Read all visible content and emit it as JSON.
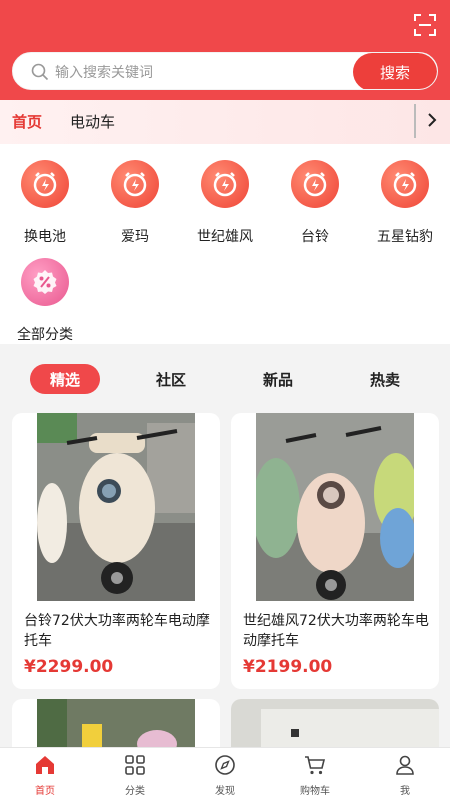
{
  "search": {
    "placeholder": "输入搜索关键词",
    "button": "搜索"
  },
  "categories": [
    {
      "label": "首页",
      "active": true
    },
    {
      "label": "电动车",
      "active": false
    }
  ],
  "brands": [
    {
      "label": "换电池",
      "icon": "alarm-bolt-icon"
    },
    {
      "label": "爱玛",
      "icon": "alarm-bolt-icon"
    },
    {
      "label": "世纪雄风",
      "icon": "alarm-bolt-icon"
    },
    {
      "label": "台铃",
      "icon": "alarm-bolt-icon"
    },
    {
      "label": "五星钻豹",
      "icon": "alarm-bolt-icon"
    },
    {
      "label": "全部分类",
      "icon": "discount-badge-icon"
    }
  ],
  "feed_tabs": [
    {
      "label": "精选",
      "active": true
    },
    {
      "label": "社区",
      "active": false
    },
    {
      "label": "新品",
      "active": false
    },
    {
      "label": "热卖",
      "active": false
    }
  ],
  "products": [
    {
      "title": "台铃72伏大功率两轮车电动摩托车",
      "price": "¥2299.00"
    },
    {
      "title": "世纪雄风72伏大功率两轮车电动摩托车",
      "price": "¥2199.00"
    }
  ],
  "nav": [
    {
      "label": "首页",
      "icon": "home-icon",
      "active": true
    },
    {
      "label": "分类",
      "icon": "grid-icon",
      "active": false
    },
    {
      "label": "发现",
      "icon": "compass-icon",
      "active": false
    },
    {
      "label": "购物车",
      "icon": "cart-icon",
      "active": false
    },
    {
      "label": "我",
      "icon": "user-icon",
      "active": false
    }
  ],
  "colors": {
    "brand_red": "#f0484a",
    "price_red": "#e53935"
  }
}
